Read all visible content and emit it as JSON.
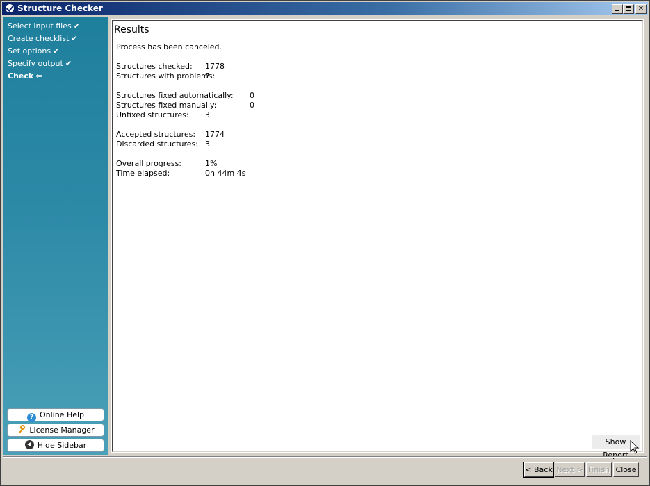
{
  "window": {
    "title": "Structure Checker"
  },
  "sidebar": {
    "steps": [
      {
        "label": "Select input files",
        "mark": "✔"
      },
      {
        "label": "Create checklist",
        "mark": "✔"
      },
      {
        "label": "Set options",
        "mark": "✔"
      },
      {
        "label": "Specify output",
        "mark": "✔"
      },
      {
        "label": "Check",
        "mark": "⇦"
      }
    ],
    "buttons": {
      "online_help": "Online Help",
      "license_manager": "License Manager",
      "hide_sidebar": "Hide Sidebar"
    }
  },
  "results": {
    "title": "Results",
    "status": "Process has been canceled.",
    "structures_checked_label": "Structures checked:",
    "structures_checked": "1778",
    "structures_with_problems_label": "Structures with problems:",
    "structures_with_problems": "7",
    "fixed_auto_label": "Structures fixed automatically:",
    "fixed_auto": "0",
    "fixed_manual_label": "Structures fixed manually:",
    "fixed_manual": "0",
    "unfixed_label": "Unfixed structures:",
    "unfixed": "3",
    "accepted_label": "Accepted structures:",
    "accepted": "1774",
    "discarded_label": "Discarded structures:",
    "discarded": "3",
    "progress_label": "Overall progress:",
    "progress": "1%",
    "elapsed_label": "Time elapsed:",
    "elapsed": "0h 44m 4s",
    "show_report": "Show Report"
  },
  "footer": {
    "back": "< Back",
    "next": "Next >",
    "finish": "Finish",
    "close": "Close"
  }
}
